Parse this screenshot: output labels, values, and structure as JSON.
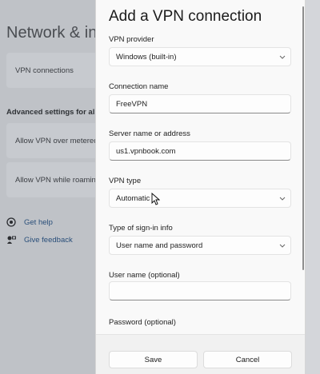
{
  "background": {
    "page_title": "Network & internet",
    "cards": [
      "VPN connections",
      "Allow VPN over metered networks",
      "Allow VPN while roaming"
    ],
    "section_heading": "Advanced settings for all VPN connections",
    "links": [
      {
        "label": "Get help",
        "icon": "help-icon"
      },
      {
        "label": "Give feedback",
        "icon": "feedback-icon"
      }
    ]
  },
  "dialog": {
    "title": "Add a VPN connection",
    "vpn_provider": {
      "label": "VPN provider",
      "value": "Windows (built-in)"
    },
    "connection_name": {
      "label": "Connection name",
      "value": "FreeVPN"
    },
    "server": {
      "label": "Server name or address",
      "value": "us1.vpnbook.com"
    },
    "vpn_type": {
      "label": "VPN type",
      "value": "Automatic"
    },
    "sign_in": {
      "label": "Type of sign-in info",
      "value": "User name and password"
    },
    "username": {
      "label": "User name (optional)",
      "value": ""
    },
    "password": {
      "label": "Password (optional)"
    },
    "save_label": "Save",
    "cancel_label": "Cancel"
  }
}
